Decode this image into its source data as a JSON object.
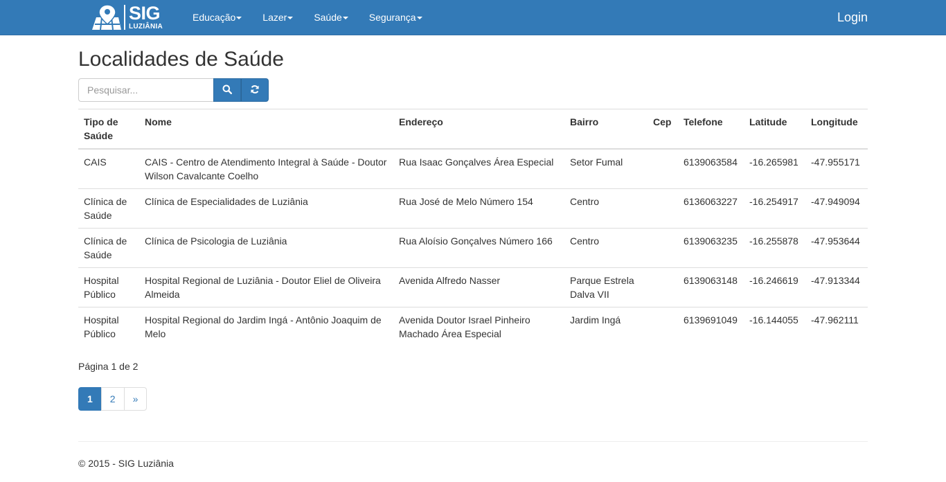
{
  "brand": {
    "main": "SIG",
    "sub": "LUZIÂNIA"
  },
  "nav": {
    "items": [
      {
        "label": "Educação"
      },
      {
        "label": "Lazer"
      },
      {
        "label": "Saúde"
      },
      {
        "label": "Segurança"
      }
    ],
    "login": "Login"
  },
  "page": {
    "title": "Localidades de Saúde"
  },
  "search": {
    "placeholder": "Pesquisar...",
    "search_icon": "search-icon",
    "refresh_icon": "refresh-icon"
  },
  "table": {
    "headers": [
      "Tipo de Saúde",
      "Nome",
      "Endereço",
      "Bairro",
      "Cep",
      "Telefone",
      "Latitude",
      "Longitude"
    ],
    "rows": [
      [
        "CAIS",
        "CAIS - Centro de Atendimento Integral à Saúde - Doutor Wilson Cavalcante Coelho",
        "Rua Isaac Gonçalves Área Especial",
        "Setor Fumal",
        "",
        "6139063584",
        "-16.265981",
        "-47.955171"
      ],
      [
        "Clínica de Saúde",
        "Clínica de Especialidades de Luziânia",
        "Rua José de Melo Número 154",
        "Centro",
        "",
        "6136063227",
        "-16.254917",
        "-47.949094"
      ],
      [
        "Clínica de Saúde",
        "Clínica de Psicologia de Luziânia",
        "Rua Aloísio Gonçalves Número 166",
        "Centro",
        "",
        "6139063235",
        "-16.255878",
        "-47.953644"
      ],
      [
        "Hospital Público",
        "Hospital Regional de Luziânia - Doutor Eliel de Oliveira Almeida",
        "Avenida Alfredo Nasser",
        "Parque Estrela Dalva VII",
        "",
        "6139063148",
        "-16.246619",
        "-47.913344"
      ],
      [
        "Hospital Público",
        "Hospital Regional do Jardim Ingá - Antônio Joaquim de Melo",
        "Avenida Doutor Israel Pinheiro Machado Área Especial",
        "Jardim Ingá",
        "",
        "6139691049",
        "-16.144055",
        "-47.962111"
      ]
    ]
  },
  "pagination": {
    "info": "Página 1 de 2",
    "pages": [
      "1",
      "2"
    ],
    "next": "»",
    "current": "1"
  },
  "footer": {
    "text": "© 2015 - SIG Luziânia"
  },
  "colors": {
    "primary": "#337ab7",
    "border": "#dddddd",
    "text": "#333333"
  }
}
